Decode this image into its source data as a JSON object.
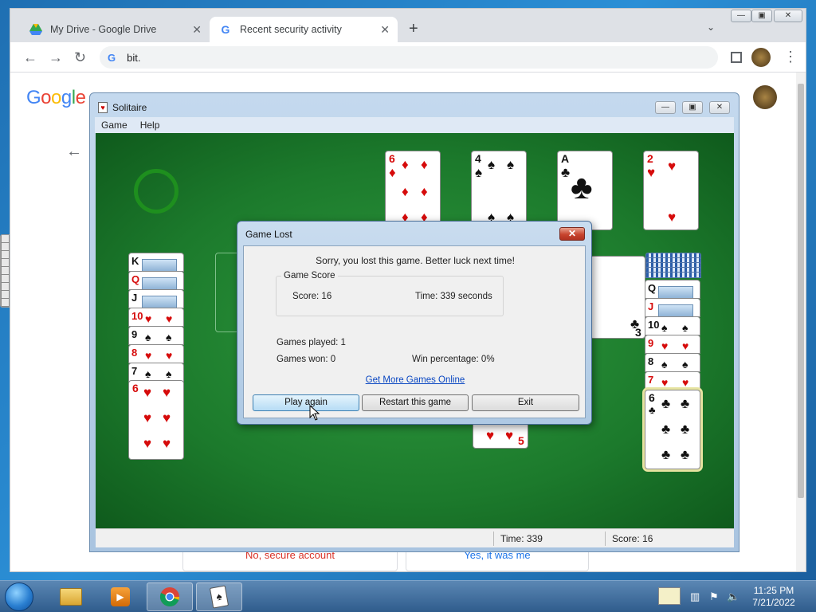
{
  "browser": {
    "tabs": [
      {
        "label": "My Drive - Google Drive"
      },
      {
        "label": "Recent security activity"
      }
    ],
    "address": "bit.",
    "google_logo": "Google",
    "hidden_buttons": {
      "no_label": "No, secure account",
      "yes_label": "Yes, it was me"
    }
  },
  "solitaire": {
    "title": "Solitaire",
    "menu": [
      "Game",
      "Help"
    ],
    "status": {
      "time": "Time:  339",
      "score": "Score: 16"
    }
  },
  "dialog": {
    "title": "Game Lost",
    "message": "Sorry, you lost this game. Better luck next time!",
    "score_group": "Game Score",
    "score": "Score: 16",
    "time": "Time:  339  seconds",
    "games_played": "Games played: 1",
    "games_won": "Games won: 0",
    "win_percentage": "Win percentage: 0%",
    "link": "Get More Games Online",
    "buttons": {
      "play": "Play again",
      "restart": "Restart this game",
      "exit": "Exit"
    }
  },
  "foundations": [
    {
      "rank": "6",
      "suit": "♦",
      "color": "red"
    },
    {
      "rank": "4",
      "suit": "♠",
      "color": "blk"
    },
    {
      "rank": "A",
      "suit": "♣",
      "color": "blk"
    },
    {
      "rank": "2",
      "suit": "♥",
      "color": "red"
    }
  ],
  "left_column": [
    {
      "rank": "K",
      "suit": "",
      "color": "blk",
      "face": true
    },
    {
      "rank": "Q",
      "suit": "",
      "color": "red",
      "face": true
    },
    {
      "rank": "J",
      "suit": "",
      "color": "blk",
      "face": true
    },
    {
      "rank": "10",
      "suit": "♥",
      "color": "red"
    },
    {
      "rank": "9",
      "suit": "♠",
      "color": "blk"
    },
    {
      "rank": "8",
      "suit": "♥",
      "color": "red"
    },
    {
      "rank": "7",
      "suit": "♠",
      "color": "blk"
    }
  ],
  "left_bottom": {
    "rank": "6",
    "suit": "♥",
    "color": "red"
  },
  "right_column": [
    {
      "rank": "Q",
      "suit": "",
      "color": "blk",
      "face": true
    },
    {
      "rank": "J",
      "suit": "",
      "color": "red",
      "face": true
    },
    {
      "rank": "10",
      "suit": "♠",
      "color": "blk"
    },
    {
      "rank": "9",
      "suit": "♥",
      "color": "red"
    },
    {
      "rank": "8",
      "suit": "♠",
      "color": "blk"
    },
    {
      "rank": "7",
      "suit": "♥",
      "color": "red"
    }
  ],
  "right_bottom": {
    "rank": "6",
    "suit": "♣",
    "color": "blk"
  },
  "middle_peek": {
    "rank": "5",
    "suit": "♥",
    "color": "red"
  },
  "side_peek": {
    "rank": "3",
    "suit": "♣",
    "color": "blk"
  },
  "taskbar": {
    "time": "11:25 PM",
    "date": "7/21/2022"
  }
}
